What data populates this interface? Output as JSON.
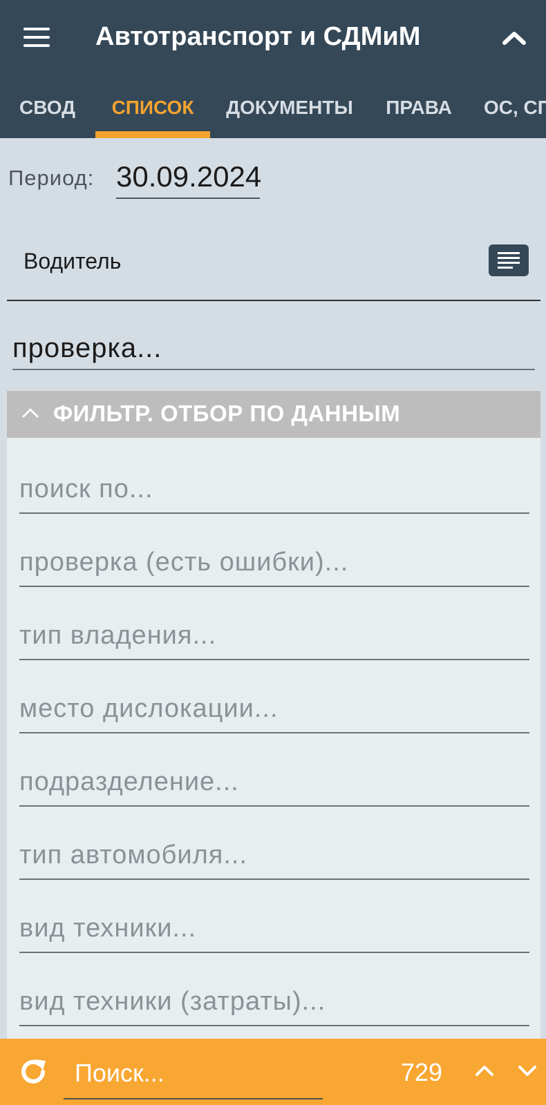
{
  "header": {
    "title": "Автотранспорт и СДМиМ",
    "menu_icon": "hamburger-icon",
    "collapse_icon": "chevron-up-icon"
  },
  "tabs": [
    {
      "label": "СВОД",
      "active": false
    },
    {
      "label": "СПИСОК",
      "active": true
    },
    {
      "label": "ДОКУМЕНТЫ",
      "active": false
    },
    {
      "label": "ПРАВА",
      "active": false
    },
    {
      "label": "ОС, СП",
      "active": false
    }
  ],
  "period": {
    "label": "Период:",
    "value": "30.09.2024"
  },
  "driver": {
    "label": "Водитель",
    "list_icon": "list-icon"
  },
  "check": {
    "placeholder": "проверка..."
  },
  "filter": {
    "title": "ФИЛЬТР. ОТБОР ПО ДАННЫМ",
    "fields": [
      "поиск по...",
      "проверка (есть ошибки)...",
      "тип владения...",
      "место дислокации...",
      "подразделение...",
      "тип автомобиля...",
      "вид техники...",
      "вид техники (затраты)..."
    ]
  },
  "bottom": {
    "search_placeholder": "Поиск...",
    "count": "729",
    "refresh_icon": "refresh-icon"
  },
  "colors": {
    "header_bg": "#354858",
    "accent": "#f5a32f",
    "bottom_bar": "#f8a733",
    "page_bg": "#d5dde4",
    "filter_header": "#bdbdbd"
  }
}
